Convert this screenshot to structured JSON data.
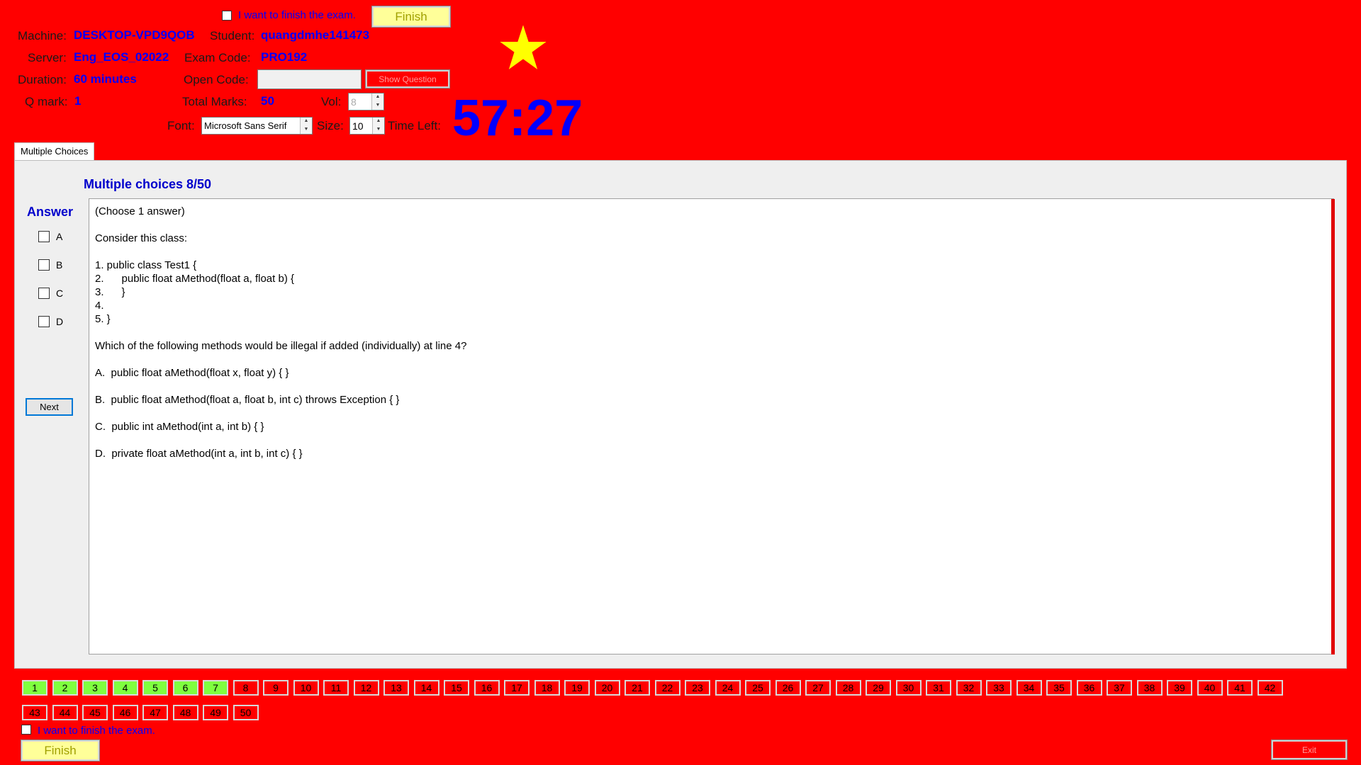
{
  "top": {
    "finish_checkbox_label": "I want to finish the exam.",
    "finish_button": "Finish"
  },
  "info": {
    "machine_label": "Machine:",
    "machine_value": "DESKTOP-VPD9QOB",
    "student_label": "Student:",
    "student_value": "quangdmhe141473",
    "server_label": "Server:",
    "server_value": "Eng_EOS_02022",
    "exam_code_label": "Exam Code:",
    "exam_code_value": "PRO192",
    "duration_label": "Duration:",
    "duration_value": "60 minutes",
    "open_code_label": "Open Code:",
    "open_code_value": "",
    "show_question_button": "Show Question",
    "qmark_label": "Q mark:",
    "qmark_value": "1",
    "total_marks_label": "Total Marks:",
    "total_marks_value": "50",
    "vol_label": "Vol:",
    "vol_value": "8",
    "font_label": "Font:",
    "font_value": "Microsoft Sans Serif",
    "size_label": "Size:",
    "size_value": "10",
    "time_left_label": "Time Left:",
    "time_left_value": "57:27"
  },
  "tab_label": "Multiple Choices",
  "question": {
    "header": "Multiple choices 8/50",
    "answer_label": "Answer",
    "options": [
      "A",
      "B",
      "C",
      "D"
    ],
    "next_button": "Next",
    "text": "(Choose 1 answer)\n\nConsider this class:\n\n1. public class Test1 {\n2.      public float aMethod(float a, float b) {\n3.      }\n4.\n5. }\n\nWhich of the following methods would be illegal if added (individually) at line 4?\n\nA.  public float aMethod(float x, float y) { }\n\nB.  public float aMethod(float a, float b, int c) throws Exception { }\n\nC.  public int aMethod(int a, int b) { }\n\nD.  private float aMethod(int a, int b, int c) { }"
  },
  "navigator": {
    "answered": [
      "1",
      "2",
      "3",
      "4",
      "5",
      "6",
      "7"
    ],
    "row1": [
      "1",
      "2",
      "3",
      "4",
      "5",
      "6",
      "7",
      "8",
      "9",
      "10",
      "11",
      "12",
      "13",
      "14",
      "15",
      "16",
      "17",
      "18",
      "19",
      "20",
      "21",
      "22",
      "23",
      "24",
      "25",
      "26",
      "27",
      "28",
      "29",
      "30",
      "31",
      "32",
      "33",
      "34",
      "35",
      "36",
      "37",
      "38",
      "39",
      "40",
      "41",
      "42"
    ],
    "row2": [
      "43",
      "44",
      "45",
      "46",
      "47",
      "48",
      "49",
      "50"
    ]
  },
  "bottom": {
    "finish_checkbox_label": "I want to finish the exam.",
    "finish_button": "Finish",
    "exit_button": "Exit"
  },
  "colors": {
    "background": "#ff0000",
    "accent_blue": "#0000ff",
    "answered": "#7fff3f",
    "star": "#ffff00"
  }
}
